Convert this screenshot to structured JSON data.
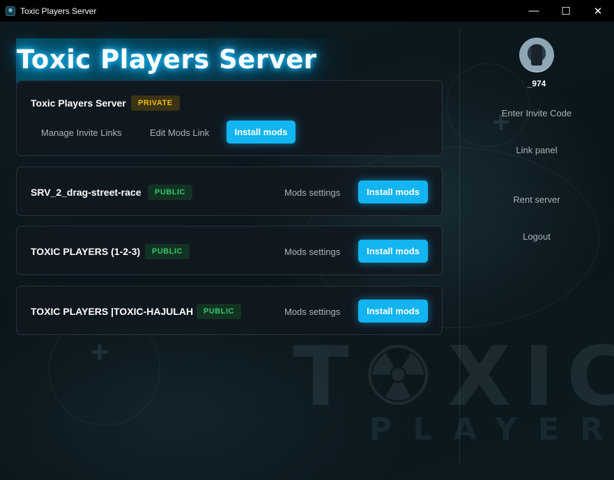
{
  "window": {
    "title": "Toxic Players Server",
    "controls": {
      "minimize": "—",
      "maximize": "☐",
      "close": "✕"
    }
  },
  "header": {
    "title": "Toxic Players Server"
  },
  "background": {
    "brand_text": "T☢XIC",
    "brand_sub": "PLAYERS"
  },
  "servers": [
    {
      "name": "Toxic Players Server",
      "badge": "PRIVATE",
      "actions": [
        "Manage Invite Links",
        "Edit Mods Link"
      ],
      "install_label": "Install mods"
    },
    {
      "name": "SRV_2_drag-street-race",
      "badge": "PUBLIC",
      "settings_label": "Mods settings",
      "install_label": "Install mods"
    },
    {
      "name": "TOXIC PLAYERS (1-2-3)",
      "badge": "PUBLIC",
      "settings_label": "Mods settings",
      "install_label": "Install mods"
    },
    {
      "name": "TOXIC PLAYERS |TOXIC-HAJULAH",
      "badge": "PUBLIC",
      "settings_label": "Mods settings",
      "install_label": "Install mods"
    }
  ],
  "sidebar": {
    "username": "_974",
    "items": [
      "Enter Invite Code",
      "Link panel",
      "Rent server",
      "Logout"
    ]
  },
  "colors": {
    "accent": "#13b4f2",
    "private_badge": "#f5b80a",
    "public_badge": "#36c46b",
    "card_bg": "#111820"
  }
}
